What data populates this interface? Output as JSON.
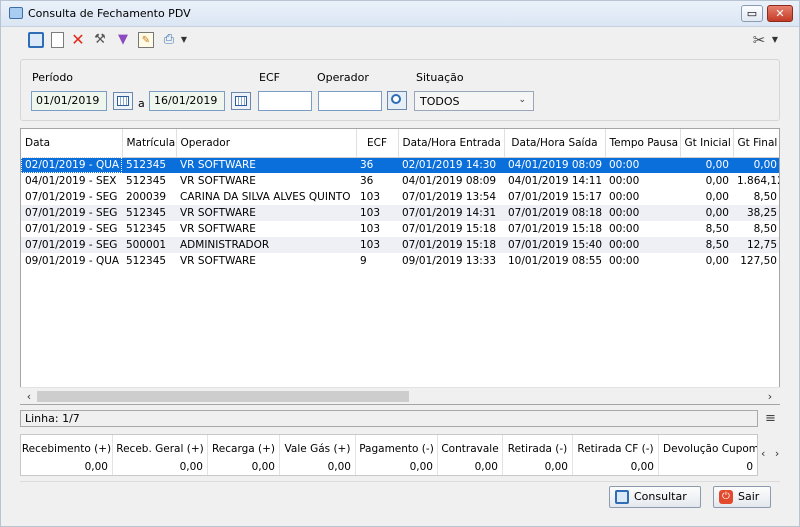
{
  "window": {
    "title": "Consulta de Fechamento PDV",
    "maximize": "▭",
    "close": "✕"
  },
  "toolbar": {
    "icons": [
      "search-icon",
      "new-document-icon",
      "delete-icon",
      "tools-icon",
      "filter-icon",
      "edit-icon",
      "print-icon",
      "dropdown-icon",
      "wrench-icon"
    ]
  },
  "filters": {
    "periodo_label": "Período",
    "date_from": "01/01/2019",
    "date_sep": "a",
    "date_to": "16/01/2019",
    "ecf_label": "ECF",
    "ecf_value": "",
    "operador_label": "Operador",
    "operador_value": "",
    "situacao_label": "Situação",
    "situacao_value": "TODOS"
  },
  "grid": {
    "columns": [
      "Data",
      "Matrícula",
      "Operador",
      "ECF",
      "Data/Hora Entrada",
      "Data/Hora Saída",
      "Tempo Pausa",
      "Gt Inicial",
      "Gt Final"
    ],
    "rows": [
      [
        "02/01/2019 - QUA",
        "512345",
        "VR SOFTWARE",
        "36",
        "02/01/2019 14:30",
        "04/01/2019 08:09",
        "00:00",
        "0,00",
        "0,00"
      ],
      [
        "04/01/2019 - SEX",
        "512345",
        "VR SOFTWARE",
        "36",
        "04/01/2019 08:09",
        "04/01/2019 14:11",
        "00:00",
        "0,00",
        "1.864,12"
      ],
      [
        "07/01/2019 - SEG",
        "200039",
        "CARINA DA SILVA ALVES QUINTO",
        "103",
        "07/01/2019 13:54",
        "07/01/2019 15:17",
        "00:00",
        "0,00",
        "8,50"
      ],
      [
        "07/01/2019 - SEG",
        "512345",
        "VR SOFTWARE",
        "103",
        "07/01/2019 14:31",
        "07/01/2019 08:18",
        "00:00",
        "0,00",
        "38,25"
      ],
      [
        "07/01/2019 - SEG",
        "512345",
        "VR SOFTWARE",
        "103",
        "07/01/2019 15:18",
        "07/01/2019 15:18",
        "00:00",
        "8,50",
        "8,50"
      ],
      [
        "07/01/2019 - SEG",
        "500001",
        "ADMINISTRADOR",
        "103",
        "07/01/2019 15:18",
        "07/01/2019 15:40",
        "00:00",
        "8,50",
        "12,75"
      ],
      [
        "09/01/2019 - QUA",
        "512345",
        "VR SOFTWARE",
        "9",
        "09/01/2019 13:33",
        "10/01/2019 08:55",
        "00:00",
        "0,00",
        "127,50"
      ]
    ]
  },
  "status": {
    "linha": "Linha: 1/7"
  },
  "totals": [
    {
      "label": "Recebimento (+)",
      "value": "0,00"
    },
    {
      "label": "Receb. Geral (+)",
      "value": "0,00"
    },
    {
      "label": "Recarga (+)",
      "value": "0,00"
    },
    {
      "label": "Vale Gás (+)",
      "value": "0,00"
    },
    {
      "label": "Pagamento (-)",
      "value": "0,00"
    },
    {
      "label": "Contravale",
      "value": "0,00"
    },
    {
      "label": "Retirada (-)",
      "value": "0,00"
    },
    {
      "label": "Retirada CF (-)",
      "value": "0,00"
    },
    {
      "label": "Devolução Cupom (",
      "value": "0"
    }
  ],
  "buttons": {
    "consultar": "Consultar",
    "sair": "Sair"
  }
}
